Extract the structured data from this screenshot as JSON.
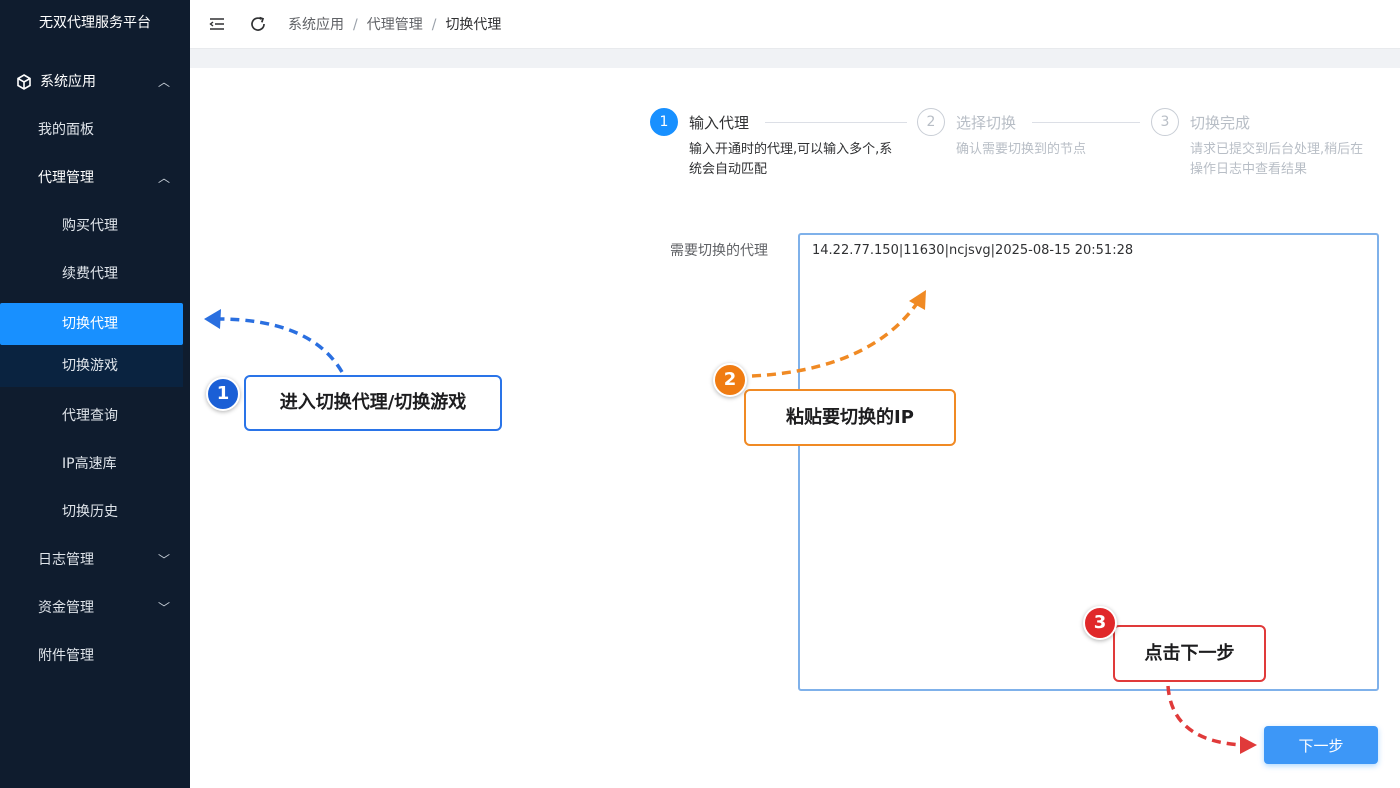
{
  "sidebar": {
    "logo": "无双代理服务平台",
    "items": [
      {
        "label": "系统应用"
      },
      {
        "label": "我的面板"
      },
      {
        "label": "代理管理"
      },
      {
        "label": "购买代理"
      },
      {
        "label": "续费代理"
      },
      {
        "label": "切换代理"
      },
      {
        "label": "切换游戏"
      },
      {
        "label": "代理查询"
      },
      {
        "label": "IP高速库"
      },
      {
        "label": "切换历史"
      },
      {
        "label": "日志管理"
      },
      {
        "label": "资金管理"
      },
      {
        "label": "附件管理"
      }
    ]
  },
  "header": {
    "breadcrumb": [
      "系统应用",
      "代理管理",
      "切换代理"
    ],
    "separator": "/"
  },
  "steps": [
    {
      "num": "1",
      "title": "输入代理",
      "desc1": "输入开通时的代理,可以输入多个,系",
      "desc2": "统会自动匹配"
    },
    {
      "num": "2",
      "title": "选择切换",
      "desc1": "确认需要切换到的节点"
    },
    {
      "num": "3",
      "title": "切换完成",
      "desc1": "请求已提交到后台处理,稍后在",
      "desc2": "操作日志中查看结果"
    }
  ],
  "form": {
    "label": "需要切换的代理",
    "value": "14.22.77.150|11630|ncjsvg|2025-08-15 20:51:28"
  },
  "next_button": "下一步",
  "annotations": [
    {
      "num": "1",
      "text": "进入切换代理/切换游戏",
      "color": "#2a74e8"
    },
    {
      "num": "2",
      "text": "粘贴要切换的IP",
      "color": "#f08a24"
    },
    {
      "num": "3",
      "text": "点击下一步",
      "color": "#e03a3a"
    }
  ],
  "colors": {
    "sidebar_bg": "#0f1c2e",
    "accent": "#1890ff"
  }
}
